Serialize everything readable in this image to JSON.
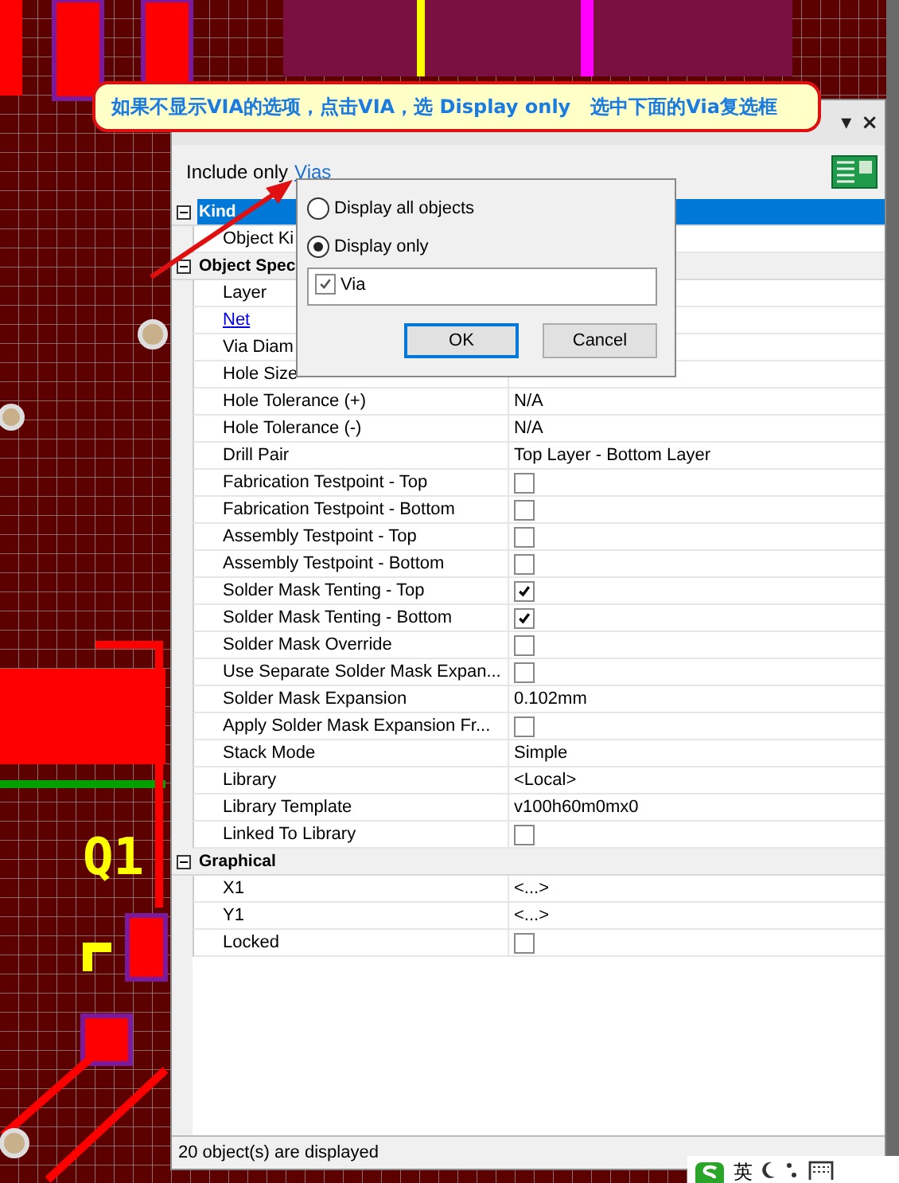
{
  "canvas": {
    "designator": "Q1"
  },
  "callout": {
    "text": "如果不显示VIA的选项，点击VIA，选 Display only   选中下面的Via复选框"
  },
  "panel": {
    "title_controls": [
      "▾",
      "×"
    ],
    "include_label": "Include only",
    "include_link": "Vias",
    "groups": [
      {
        "title": "Kind",
        "selected": true,
        "expanded": true,
        "rows": [
          {
            "label": "Object Ki",
            "link": false,
            "kind": "text",
            "value": ""
          }
        ]
      },
      {
        "title": "Object Spec",
        "selected": false,
        "expanded": true,
        "rows": [
          {
            "label": "Layer",
            "link": false,
            "kind": "text",
            "value": ""
          },
          {
            "label": "Net",
            "link": true,
            "kind": "text",
            "value": ""
          },
          {
            "label": "Via Diam",
            "link": false,
            "kind": "text",
            "value": ""
          },
          {
            "label": "Hole Size",
            "link": false,
            "kind": "text",
            "value": ""
          },
          {
            "label": "Hole Tolerance (+)",
            "link": false,
            "kind": "text",
            "value": "N/A"
          },
          {
            "label": "Hole Tolerance (-)",
            "link": false,
            "kind": "text",
            "value": "N/A"
          },
          {
            "label": "Drill Pair",
            "link": false,
            "kind": "text",
            "value": "Top Layer - Bottom Layer"
          },
          {
            "label": "Fabrication Testpoint - Top",
            "link": false,
            "kind": "check",
            "checked": false
          },
          {
            "label": "Fabrication Testpoint - Bottom",
            "link": false,
            "kind": "check",
            "checked": false
          },
          {
            "label": "Assembly Testpoint - Top",
            "link": false,
            "kind": "check",
            "checked": false
          },
          {
            "label": "Assembly Testpoint - Bottom",
            "link": false,
            "kind": "check",
            "checked": false
          },
          {
            "label": "Solder Mask Tenting - Top",
            "link": false,
            "kind": "check",
            "checked": true
          },
          {
            "label": "Solder Mask Tenting - Bottom",
            "link": false,
            "kind": "check",
            "checked": true
          },
          {
            "label": "Solder Mask Override",
            "link": false,
            "kind": "check",
            "checked": false
          },
          {
            "label": "Use Separate Solder Mask Expan...",
            "link": false,
            "kind": "check",
            "checked": false
          },
          {
            "label": "Solder Mask Expansion",
            "link": false,
            "kind": "text",
            "value": "0.102mm"
          },
          {
            "label": "Apply Solder Mask Expansion Fr...",
            "link": false,
            "kind": "check",
            "checked": false
          },
          {
            "label": "Stack Mode",
            "link": false,
            "kind": "text",
            "value": "Simple"
          },
          {
            "label": "Library",
            "link": false,
            "kind": "text",
            "value": "<Local>"
          },
          {
            "label": "Library Template",
            "link": false,
            "kind": "text",
            "value": "v100h60m0mx0"
          },
          {
            "label": "Linked To Library",
            "link": false,
            "kind": "check",
            "checked": false
          }
        ]
      },
      {
        "title": "Graphical",
        "selected": false,
        "expanded": true,
        "rows": [
          {
            "label": "X1",
            "link": false,
            "kind": "text",
            "value": "<...>"
          },
          {
            "label": "Y1",
            "link": false,
            "kind": "text",
            "value": "<...>"
          },
          {
            "label": "Locked",
            "link": false,
            "kind": "check",
            "checked": false
          }
        ]
      }
    ],
    "status": "20 object(s) are displayed"
  },
  "popup": {
    "options": [
      {
        "label": "Display all objects",
        "selected": false
      },
      {
        "label": "Display only",
        "selected": true
      }
    ],
    "items": [
      {
        "label": "Via",
        "checked": true
      }
    ],
    "buttons": [
      {
        "label": "OK",
        "focused": true
      },
      {
        "label": "Cancel",
        "focused": false
      }
    ]
  },
  "ime_bar": {
    "language": "英"
  }
}
